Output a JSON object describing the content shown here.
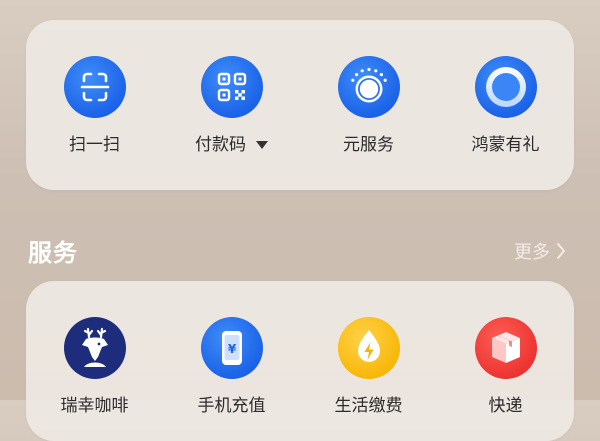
{
  "quick_actions": [
    {
      "label": "扫一扫",
      "icon": "scan-icon"
    },
    {
      "label": "付款码",
      "icon": "qr-code-icon"
    },
    {
      "label": "元服务",
      "icon": "atomic-service-icon"
    },
    {
      "label": "鸿蒙有礼",
      "icon": "ring-icon"
    }
  ],
  "services_section": {
    "title": "服务",
    "more_label": "更多"
  },
  "services": [
    {
      "label": "瑞幸咖啡",
      "icon": "deer-logo-icon"
    },
    {
      "label": "手机充值",
      "icon": "phone-recharge-icon",
      "glyph": "¥"
    },
    {
      "label": "生活缴费",
      "icon": "utility-bill-icon"
    },
    {
      "label": "快递",
      "icon": "package-icon"
    }
  ],
  "colors": {
    "accent_blue": "#1b63e8",
    "luckin_navy": "#1d2d7c",
    "bill_yellow": "#f7b400",
    "express_red": "#ea2f2c"
  }
}
